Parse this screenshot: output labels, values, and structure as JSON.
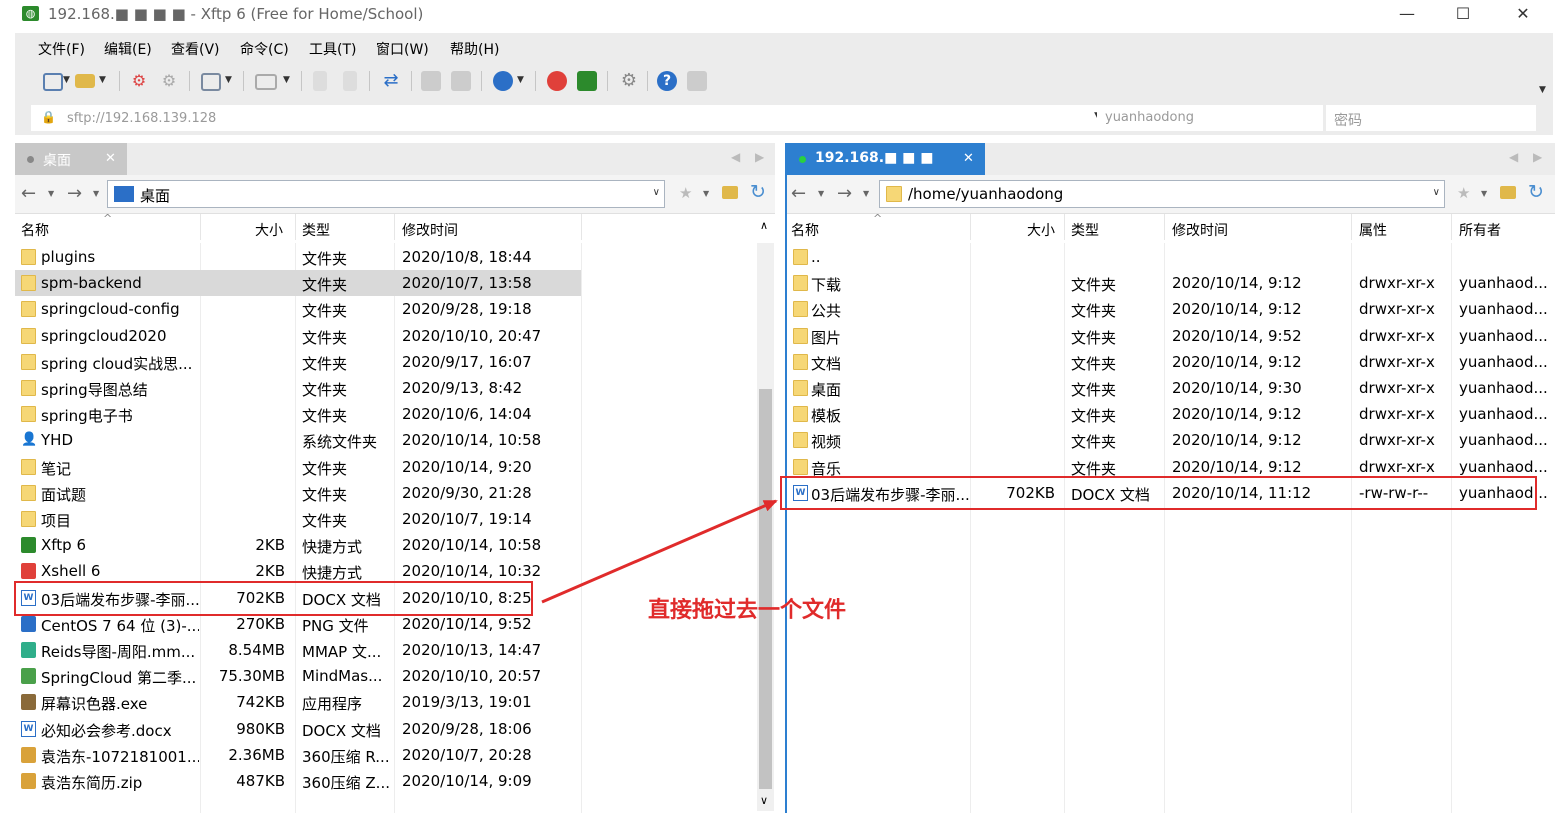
{
  "window": {
    "title": "192.168.■ ■ ■ ■ - Xftp 6 (Free for Home/School)",
    "minimize": "—",
    "maximize": "☐",
    "close": "✕"
  },
  "menu": [
    "文件(F)",
    "编辑(E)",
    "查看(V)",
    "命令(C)",
    "工具(T)",
    "窗口(W)",
    "帮助(H)"
  ],
  "address": {
    "url": "sftp://192.168.139.128",
    "username": "yuanhaodong",
    "password_placeholder": "密码"
  },
  "colors": {
    "accent": "#2b6fc7",
    "active_tab": "#2d7fd0",
    "annotation": "#e02b2b",
    "folder": "#f6d776"
  },
  "local": {
    "tab_label": "桌面",
    "path": "桌面",
    "columns": [
      "名称",
      "大小",
      "类型",
      "修改时间"
    ],
    "rows": [
      {
        "name": "plugins",
        "size": "",
        "type": "文件夹",
        "modified": "2020/10/8, 18:44",
        "icon": "folder-icon"
      },
      {
        "name": "spm-backend",
        "size": "",
        "type": "文件夹",
        "modified": "2020/10/7, 13:58",
        "icon": "folder-icon"
      },
      {
        "name": "springcloud-config",
        "size": "",
        "type": "文件夹",
        "modified": "2020/9/28, 19:18",
        "icon": "folder-icon"
      },
      {
        "name": "springcloud2020",
        "size": "",
        "type": "文件夹",
        "modified": "2020/10/10, 20:47",
        "icon": "folder-icon"
      },
      {
        "name": "spring cloud实战思...",
        "size": "",
        "type": "文件夹",
        "modified": "2020/9/17, 16:07",
        "icon": "folder-icon"
      },
      {
        "name": "spring导图总结",
        "size": "",
        "type": "文件夹",
        "modified": "2020/9/13, 8:42",
        "icon": "folder-icon"
      },
      {
        "name": "spring电子书",
        "size": "",
        "type": "文件夹",
        "modified": "2020/10/6, 14:04",
        "icon": "folder-icon"
      },
      {
        "name": "YHD",
        "size": "",
        "type": "系统文件夹",
        "modified": "2020/10/14, 10:58",
        "icon": "user-icon"
      },
      {
        "name": "笔记",
        "size": "",
        "type": "文件夹",
        "modified": "2020/10/14, 9:20",
        "icon": "folder-icon"
      },
      {
        "name": "面试题",
        "size": "",
        "type": "文件夹",
        "modified": "2020/9/30, 21:28",
        "icon": "folder-icon"
      },
      {
        "name": "项目",
        "size": "",
        "type": "文件夹",
        "modified": "2020/10/7, 19:14",
        "icon": "folder-icon"
      },
      {
        "name": "Xftp 6",
        "size": "2KB",
        "type": "快捷方式",
        "modified": "2020/10/14, 10:58",
        "icon": "xftp-icon"
      },
      {
        "name": "Xshell 6",
        "size": "2KB",
        "type": "快捷方式",
        "modified": "2020/10/14, 10:32",
        "icon": "xshell-icon"
      },
      {
        "name": "03后端发布步骤-李丽...",
        "size": "702KB",
        "type": "DOCX 文档",
        "modified": "2020/10/10, 8:25",
        "icon": "docx-icon"
      },
      {
        "name": "CentOS 7 64 位 (3)-...",
        "size": "270KB",
        "type": "PNG 文件",
        "modified": "2020/10/14, 9:52",
        "icon": "png-icon"
      },
      {
        "name": "Reids导图-周阳.mm...",
        "size": "8.54MB",
        "type": "MMAP 文...",
        "modified": "2020/10/13, 14:47",
        "icon": "mindmap-icon"
      },
      {
        "name": "SpringCloud 第二季...",
        "size": "75.30MB",
        "type": "MindMas...",
        "modified": "2020/10/10, 20:57",
        "icon": "mindmaster-icon"
      },
      {
        "name": "屏幕识色器.exe",
        "size": "742KB",
        "type": "应用程序",
        "modified": "2019/3/13, 19:01",
        "icon": "exe-icon"
      },
      {
        "name": "必知必会参考.docx",
        "size": "980KB",
        "type": "DOCX 文档",
        "modified": "2020/9/28, 18:06",
        "icon": "docx-icon"
      },
      {
        "name": "袁浩东-1072181001...",
        "size": "2.36MB",
        "type": "360压缩 R...",
        "modified": "2020/10/7, 20:28",
        "icon": "archive-icon"
      },
      {
        "name": "袁浩东简历.zip",
        "size": "487KB",
        "type": "360压缩 Z...",
        "modified": "2020/10/14, 9:09",
        "icon": "archive-icon"
      }
    ]
  },
  "remote": {
    "tab_label": "192.168.■ ■ ■",
    "path": "/home/yuanhaodong",
    "columns": [
      "名称",
      "大小",
      "类型",
      "修改时间",
      "属性",
      "所有者"
    ],
    "rows": [
      {
        "name": "..",
        "size": "",
        "type": "",
        "modified": "",
        "attr": "",
        "owner": "",
        "icon": "folder-icon"
      },
      {
        "name": "下载",
        "size": "",
        "type": "文件夹",
        "modified": "2020/10/14, 9:12",
        "attr": "drwxr-xr-x",
        "owner": "yuanhaod...",
        "icon": "folder-icon"
      },
      {
        "name": "公共",
        "size": "",
        "type": "文件夹",
        "modified": "2020/10/14, 9:12",
        "attr": "drwxr-xr-x",
        "owner": "yuanhaod...",
        "icon": "folder-icon"
      },
      {
        "name": "图片",
        "size": "",
        "type": "文件夹",
        "modified": "2020/10/14, 9:52",
        "attr": "drwxr-xr-x",
        "owner": "yuanhaod...",
        "icon": "folder-icon"
      },
      {
        "name": "文档",
        "size": "",
        "type": "文件夹",
        "modified": "2020/10/14, 9:12",
        "attr": "drwxr-xr-x",
        "owner": "yuanhaod...",
        "icon": "folder-icon"
      },
      {
        "name": "桌面",
        "size": "",
        "type": "文件夹",
        "modified": "2020/10/14, 9:30",
        "attr": "drwxr-xr-x",
        "owner": "yuanhaod...",
        "icon": "folder-icon"
      },
      {
        "name": "模板",
        "size": "",
        "type": "文件夹",
        "modified": "2020/10/14, 9:12",
        "attr": "drwxr-xr-x",
        "owner": "yuanhaod...",
        "icon": "folder-icon"
      },
      {
        "name": "视频",
        "size": "",
        "type": "文件夹",
        "modified": "2020/10/14, 9:12",
        "attr": "drwxr-xr-x",
        "owner": "yuanhaod...",
        "icon": "folder-icon"
      },
      {
        "name": "音乐",
        "size": "",
        "type": "文件夹",
        "modified": "2020/10/14, 9:12",
        "attr": "drwxr-xr-x",
        "owner": "yuanhaod...",
        "icon": "folder-icon"
      },
      {
        "name": "03后端发布步骤-李丽...",
        "size": "702KB",
        "type": "DOCX 文档",
        "modified": "2020/10/14, 11:12",
        "attr": "-rw-rw-r--",
        "owner": "yuanhaod...",
        "icon": "docx-icon"
      }
    ]
  },
  "annotation": {
    "text": "直接拖过去一个文件"
  }
}
